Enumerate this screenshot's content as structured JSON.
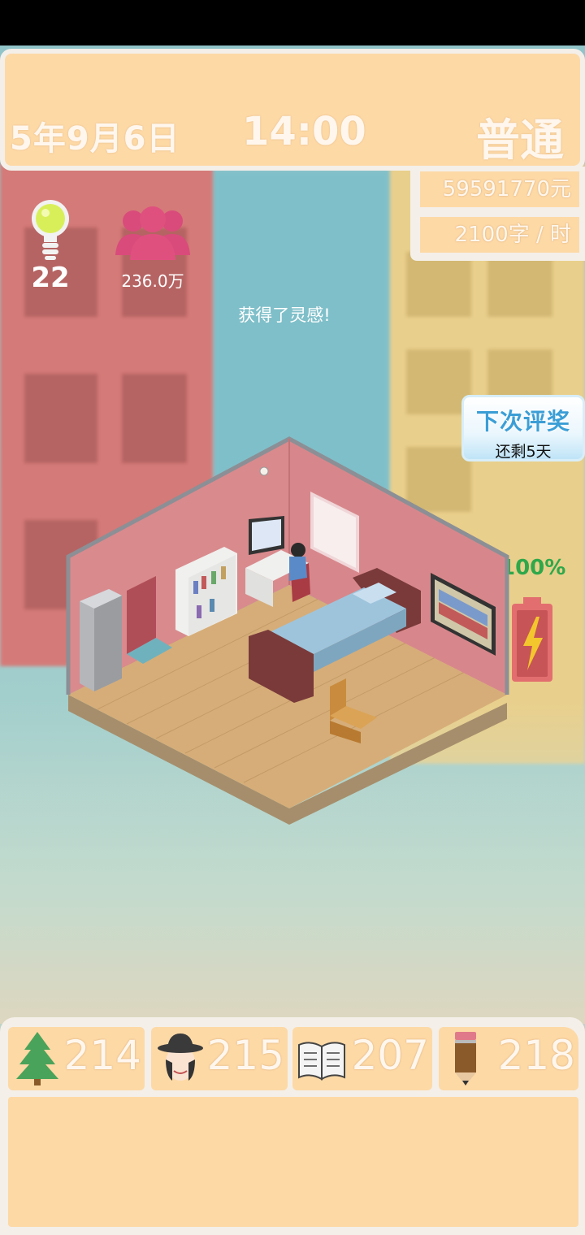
{
  "top": {
    "date": "5年9月6日",
    "time": "14:00",
    "mode": "普通"
  },
  "stats": {
    "money": "59591770元",
    "rate": "2100字 / 时"
  },
  "hud": {
    "inspiration_count": "22",
    "fans_count": "236.0万",
    "message": "获得了灵感!"
  },
  "award": {
    "title": "下次评奖",
    "remaining": "还剩5天"
  },
  "battery": {
    "percent": "100%",
    "color": "#e36e6f",
    "bolt_color": "#f3c62e"
  },
  "attributes": [
    {
      "icon": "tree-icon",
      "value": "214"
    },
    {
      "icon": "detective-hat-icon",
      "value": "215"
    },
    {
      "icon": "open-book-icon",
      "value": "207"
    },
    {
      "icon": "pencil-icon",
      "value": "218"
    }
  ],
  "colors": {
    "panel": "#fdd9a6",
    "frame": "#f4efe9",
    "wall": "#d98a8d",
    "floor": "#d6ad78",
    "bed": "#9ec4dc",
    "award_text": "#3b9ed6"
  }
}
